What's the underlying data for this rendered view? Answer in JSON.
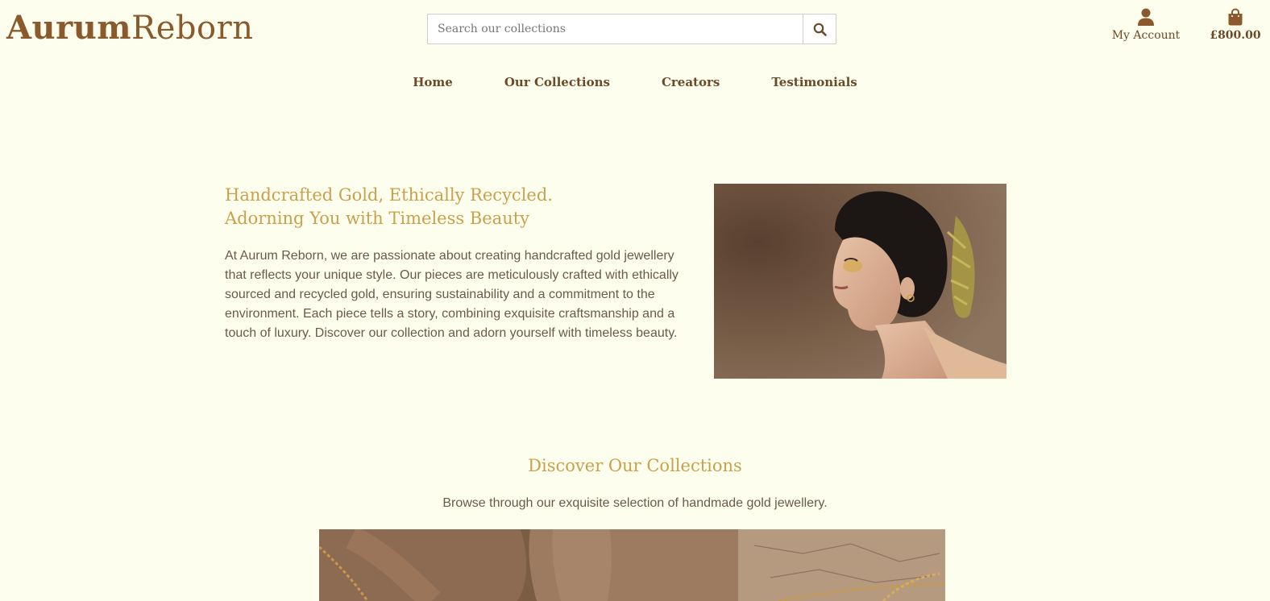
{
  "brand": {
    "name_bold": "Aurum",
    "name_light": "Reborn"
  },
  "search": {
    "placeholder": "Search our collections",
    "icon": "magnifier"
  },
  "header": {
    "account_label": "My Account",
    "account_icon": "user",
    "bag_total": "£800.00",
    "bag_icon": "shopping-bag"
  },
  "nav": {
    "items": [
      {
        "label": "Home"
      },
      {
        "label": "Our Collections"
      },
      {
        "label": "Creators"
      },
      {
        "label": "Testimonials"
      }
    ]
  },
  "hero": {
    "title_line1": "Handcrafted Gold, Ethically Recycled.",
    "title_line2": "Adorning You with Timeless Beauty",
    "body": "At Aurum Reborn, we are passionate about creating handcrafted gold jewellery that reflects your unique style. Our pieces are meticulously crafted with ethically sourced and recycled gold, ensuring sustainability and a commitment to the environment. Each piece tells a story, combining exquisite craftsmanship and a touch of luxury. Discover our collection and adorn yourself with timeless beauty."
  },
  "collections": {
    "title": "Discover Our Collections",
    "subtitle": "Browse through our exquisite selection of handmade gold jewellery."
  },
  "colors": {
    "background": "#FEFEEE",
    "brand_brown": "#8a5a2c",
    "accent_gold": "#c9a14c",
    "body_text": "#6b5a4a"
  }
}
